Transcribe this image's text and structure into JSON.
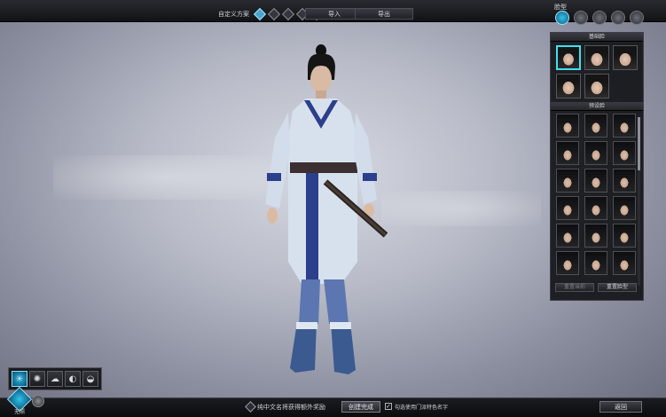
{
  "topbar": {
    "preset_label": "自定义方案",
    "preset_slots": [
      {
        "icon": "preset-slot-1-icon",
        "active": true
      },
      {
        "icon": "preset-slot-2-icon",
        "active": false
      },
      {
        "icon": "preset-slot-3-icon",
        "active": false
      },
      {
        "icon": "preset-slot-4-icon",
        "active": false
      },
      {
        "icon": "preset-slot-5-icon",
        "active": false
      }
    ],
    "import_label": "导入",
    "export_label": "导出",
    "tabs_label": "脸型",
    "tabs": [
      {
        "icon": "face-shape-tab-icon",
        "active": true
      },
      {
        "icon": "face-detail-tab-icon",
        "active": false
      },
      {
        "icon": "hair-tab-icon",
        "active": false
      },
      {
        "icon": "makeup-tab-icon",
        "active": false
      },
      {
        "icon": "body-tab-icon",
        "active": false
      }
    ]
  },
  "panel": {
    "base_header": "基础脸",
    "base_faces": 5,
    "selected_base_face": 0,
    "preset_header": "预设脸",
    "preset_faces": 18,
    "reset_current_label": "重置当前",
    "reset_face_label": "重置脸型"
  },
  "light_toolbar": {
    "icons": [
      {
        "name": "sun-light-icon",
        "glyph": "☀",
        "active": true
      },
      {
        "name": "dim-light-icon",
        "glyph": "✺",
        "active": false
      },
      {
        "name": "cloudy-light-icon",
        "glyph": "☁",
        "active": false
      },
      {
        "name": "contrast-light-icon",
        "glyph": "◐",
        "active": false
      },
      {
        "name": "dome-light-icon",
        "glyph": "◒",
        "active": false
      }
    ]
  },
  "bottombar": {
    "mode_label": "无照",
    "bonus_text": "纯中文名将获得额外奖励",
    "create_label": "创建完成",
    "checkbox_checked": true,
    "checkbox_label": "勾选使用门派特色名字",
    "back_label": "返回"
  },
  "colors": {
    "accent": "#38c0e8",
    "panel_bg": "#141519",
    "selection": "#40e0f0"
  }
}
